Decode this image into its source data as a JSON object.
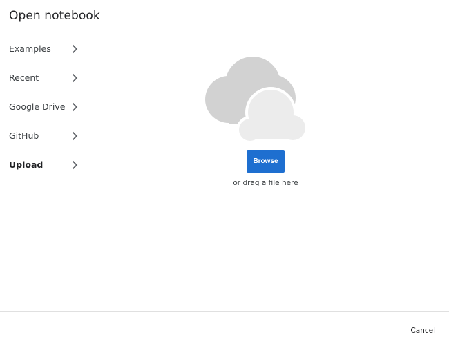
{
  "dialog": {
    "title": "Open notebook"
  },
  "sidebar": {
    "items": [
      {
        "label": "Examples",
        "icon": "chevron-right-icon"
      },
      {
        "label": "Recent",
        "icon": "chevron-right-icon"
      },
      {
        "label": "Google Drive",
        "icon": "chevron-right-icon"
      },
      {
        "label": "GitHub",
        "icon": "chevron-right-icon"
      },
      {
        "label": "Upload",
        "icon": "chevron-right-icon",
        "active": true
      }
    ]
  },
  "upload": {
    "illustration": "cloud-icon",
    "browse_label": "Browse",
    "drag_text": "or drag a file here",
    "accent_color": "#1e6fd0"
  },
  "footer": {
    "cancel_label": "Cancel"
  }
}
